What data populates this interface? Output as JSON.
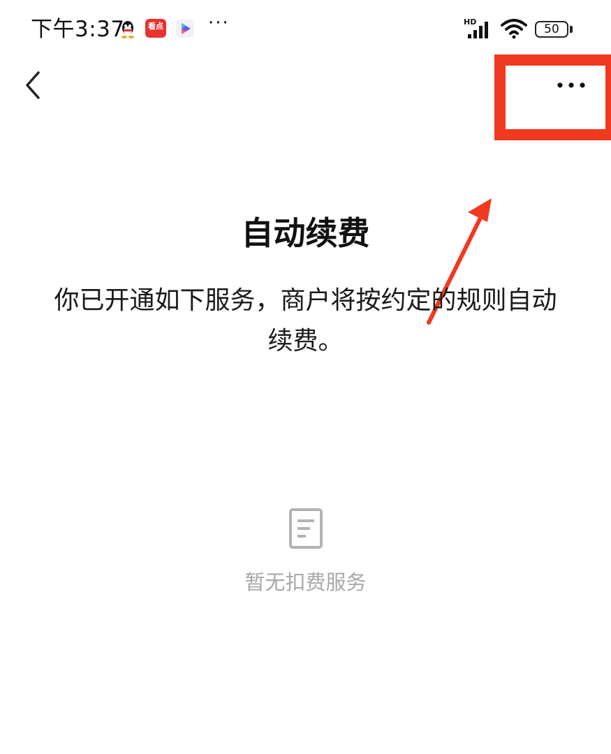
{
  "status_bar": {
    "time": "下午3:37",
    "notification_icons": [
      "qq-icon",
      "kandian-app-icon",
      "video-app-icon"
    ],
    "kandian_label": "看点",
    "more": "···",
    "network_label": "HD",
    "battery_level": "50"
  },
  "nav": {
    "back_icon": "chevron-left-icon",
    "more_icon": "more-horizontal-icon"
  },
  "annotation": {
    "highlight_color": "#f0391f",
    "arrow_color": "#f0391f"
  },
  "content": {
    "title": "自动续费",
    "description": "你已开通如下服务，商户将按约定的规则自动续费。"
  },
  "empty_state": {
    "icon": "document-icon",
    "text": "暂无扣费服务"
  },
  "colors": {
    "background": "#ffffff",
    "text_primary": "#111111",
    "text_muted": "#a8a8a8",
    "annotation_red": "#f0391f"
  }
}
